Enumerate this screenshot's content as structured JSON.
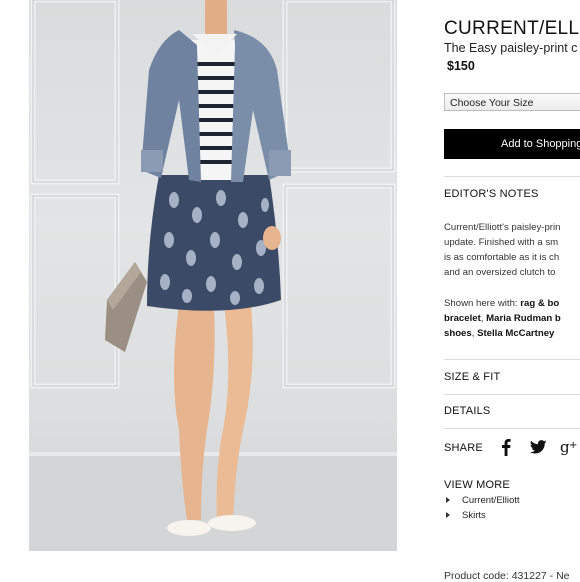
{
  "product": {
    "brand": "CURRENT/ELLI",
    "subtitle": "The Easy paisley-print c",
    "price": "$150",
    "size_placeholder": "Choose Your Size",
    "add_button": "Add to Shopping",
    "product_code": "Product code: 431227 - Ne"
  },
  "sections": {
    "editors_notes": "EDITOR'S NOTES",
    "size_fit": "SIZE & FIT",
    "details": "DETAILS",
    "share": "SHARE",
    "view_more": "VIEW MORE"
  },
  "editors_text": {
    "line1": "Current/Elliott's paisley-prin",
    "line2": "update. Finished with a sm",
    "line3": "is as comfortable as it is ch",
    "line4": "and an oversized clutch to"
  },
  "shown_with": {
    "prefix": "Shown here with: ",
    "item1": "rag & bo",
    "item2": "bracelet",
    "sep1": ", ",
    "item3": "Maria Rudman b",
    "item4": "shoes",
    "sep2": ", ",
    "item5": "Stella McCartney"
  },
  "view_more_links": [
    "Current/Elliott",
    "Skirts"
  ],
  "share_icons": [
    "facebook-icon",
    "twitter-icon",
    "google-plus-icon"
  ],
  "colors": {
    "button_bg": "#000000",
    "divider": "#dcdcdc",
    "photo_wall": "#dcdedf"
  }
}
